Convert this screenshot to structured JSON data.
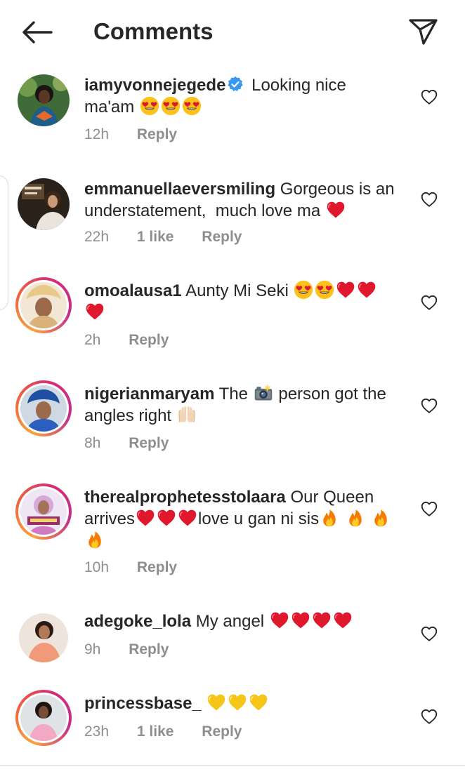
{
  "header": {
    "title": "Comments",
    "back_icon": "arrow-left-icon",
    "send_icon": "paper-plane-icon"
  },
  "colors": {
    "text": "#262626",
    "muted": "#8e8e8e",
    "verified": "#3897f0",
    "heart_emoji": "#e0182d",
    "ring_start": "#f9a33d",
    "ring_end": "#c12d8f"
  },
  "comments": [
    {
      "username": "iamyvonnejegede",
      "verified": true,
      "text_line1": "Looking nice",
      "text_line2": "ma'am",
      "emojis": [
        "heart-eyes",
        "heart-eyes",
        "heart-eyes"
      ],
      "time": "12h",
      "likes": "",
      "reply_label": "Reply",
      "has_story_ring": false
    },
    {
      "username": "emmanuellaeversmiling",
      "verified": false,
      "text_line1": "Gorgeous is an",
      "text_line2": "understatement,  much love ma",
      "emojis": [
        "red-heart"
      ],
      "time": "22h",
      "likes": "1 like",
      "reply_label": "Reply",
      "has_story_ring": false
    },
    {
      "username": "omoalausa1",
      "verified": false,
      "text_line1": "Aunty Mi Seki",
      "text_line2": "",
      "emojis": [
        "heart-eyes",
        "heart-eyes",
        "red-heart",
        "red-heart",
        "red-heart"
      ],
      "time": "2h",
      "likes": "",
      "reply_label": "Reply",
      "has_story_ring": true
    },
    {
      "username": "nigerianmaryam",
      "verified": false,
      "text_line1": "The",
      "text_mid": "person got the",
      "text_line2": "angles right",
      "emojis": [
        "camera-flash",
        "raising-hands"
      ],
      "time": "8h",
      "likes": "",
      "reply_label": "Reply",
      "has_story_ring": true
    },
    {
      "username": "therealprophetesstolaara",
      "verified": false,
      "text_line1": "Our Queen",
      "text_line2a": "arrives",
      "text_line2b": "love u gan ni sis",
      "emojis": [
        "red-heart",
        "red-heart",
        "red-heart",
        "fire",
        "fire",
        "fire",
        "fire"
      ],
      "time": "10h",
      "likes": "",
      "reply_label": "Reply",
      "has_story_ring": true
    },
    {
      "username": "adegoke_lola",
      "verified": false,
      "text_line1": "My angel",
      "text_line2": "",
      "emojis": [
        "red-heart",
        "red-heart",
        "red-heart",
        "red-heart"
      ],
      "time": "9h",
      "likes": "",
      "reply_label": "Reply",
      "has_story_ring": false
    },
    {
      "username": "princessbase_",
      "verified": false,
      "text_line1": "",
      "text_line2": "",
      "emojis": [
        "yellow-heart",
        "yellow-heart",
        "yellow-heart"
      ],
      "time": "23h",
      "likes": "1 like",
      "reply_label": "Reply",
      "has_story_ring": true
    }
  ],
  "like_icon": "heart-outline-icon"
}
